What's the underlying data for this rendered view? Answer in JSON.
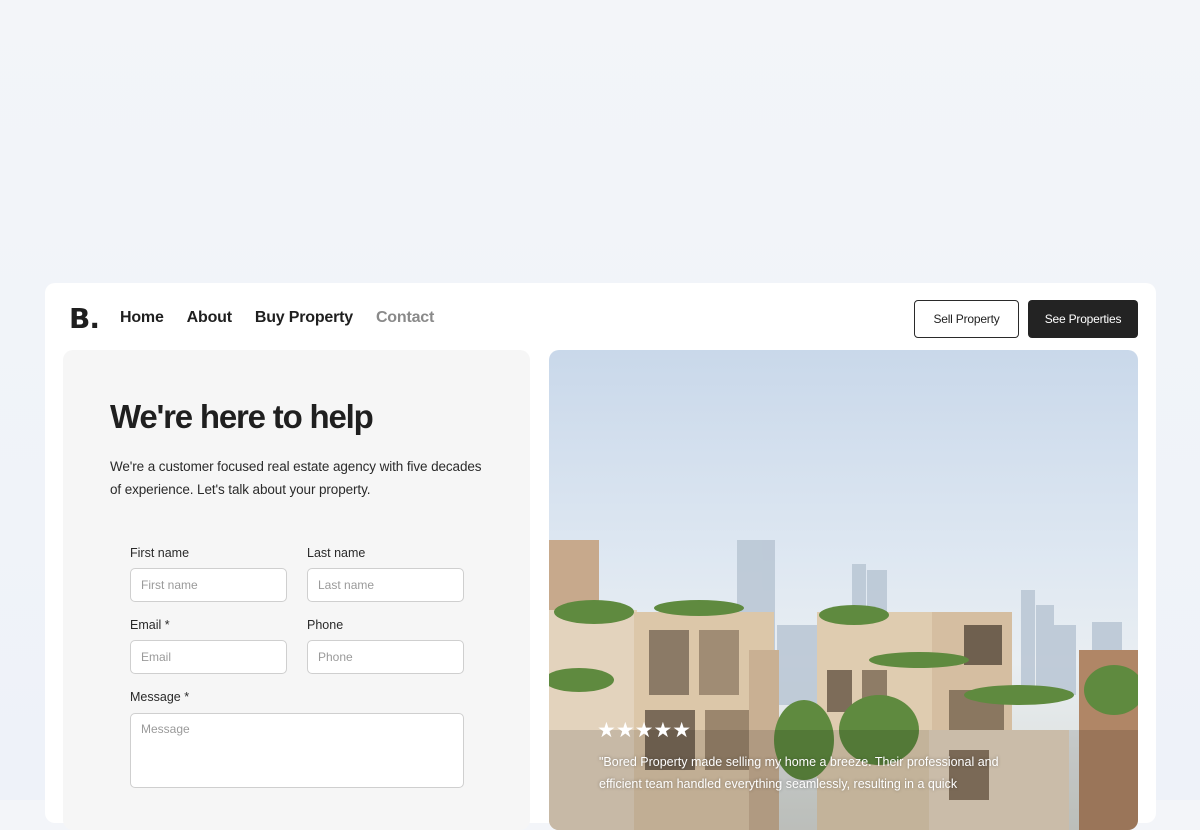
{
  "brand": {
    "logo_text": "B."
  },
  "nav": {
    "links": [
      {
        "label": "Home",
        "active": false
      },
      {
        "label": "About",
        "active": false
      },
      {
        "label": "Buy Property",
        "active": false
      },
      {
        "label": "Contact",
        "active": true
      }
    ],
    "sell_button": "Sell Property",
    "see_button": "See Properties"
  },
  "form": {
    "title": "We're here to help",
    "intro": "We're a customer focused real estate agency with five decades of experience. Let's talk about your property.",
    "first_name": {
      "label": "First name",
      "placeholder": "First name",
      "value": ""
    },
    "last_name": {
      "label": "Last name",
      "placeholder": "Last name",
      "value": ""
    },
    "email": {
      "label": "Email *",
      "placeholder": "Email",
      "value": ""
    },
    "phone": {
      "label": "Phone",
      "placeholder": "Phone",
      "value": ""
    },
    "message": {
      "label": "Message *",
      "placeholder": "Message",
      "value": ""
    }
  },
  "testimonial": {
    "rating": 5,
    "stars": "★★★★★",
    "quote": "\"Bored Property made selling my home a breeze. Their professional and efficient team handled everything seamlessly, resulting in a quick"
  },
  "colors": {
    "page_bg": "#f1f4f9",
    "card_bg": "#ffffff",
    "panel_bg": "#f6f6f6",
    "dark_button": "#232323",
    "active_nav": "#8a8a8a"
  }
}
